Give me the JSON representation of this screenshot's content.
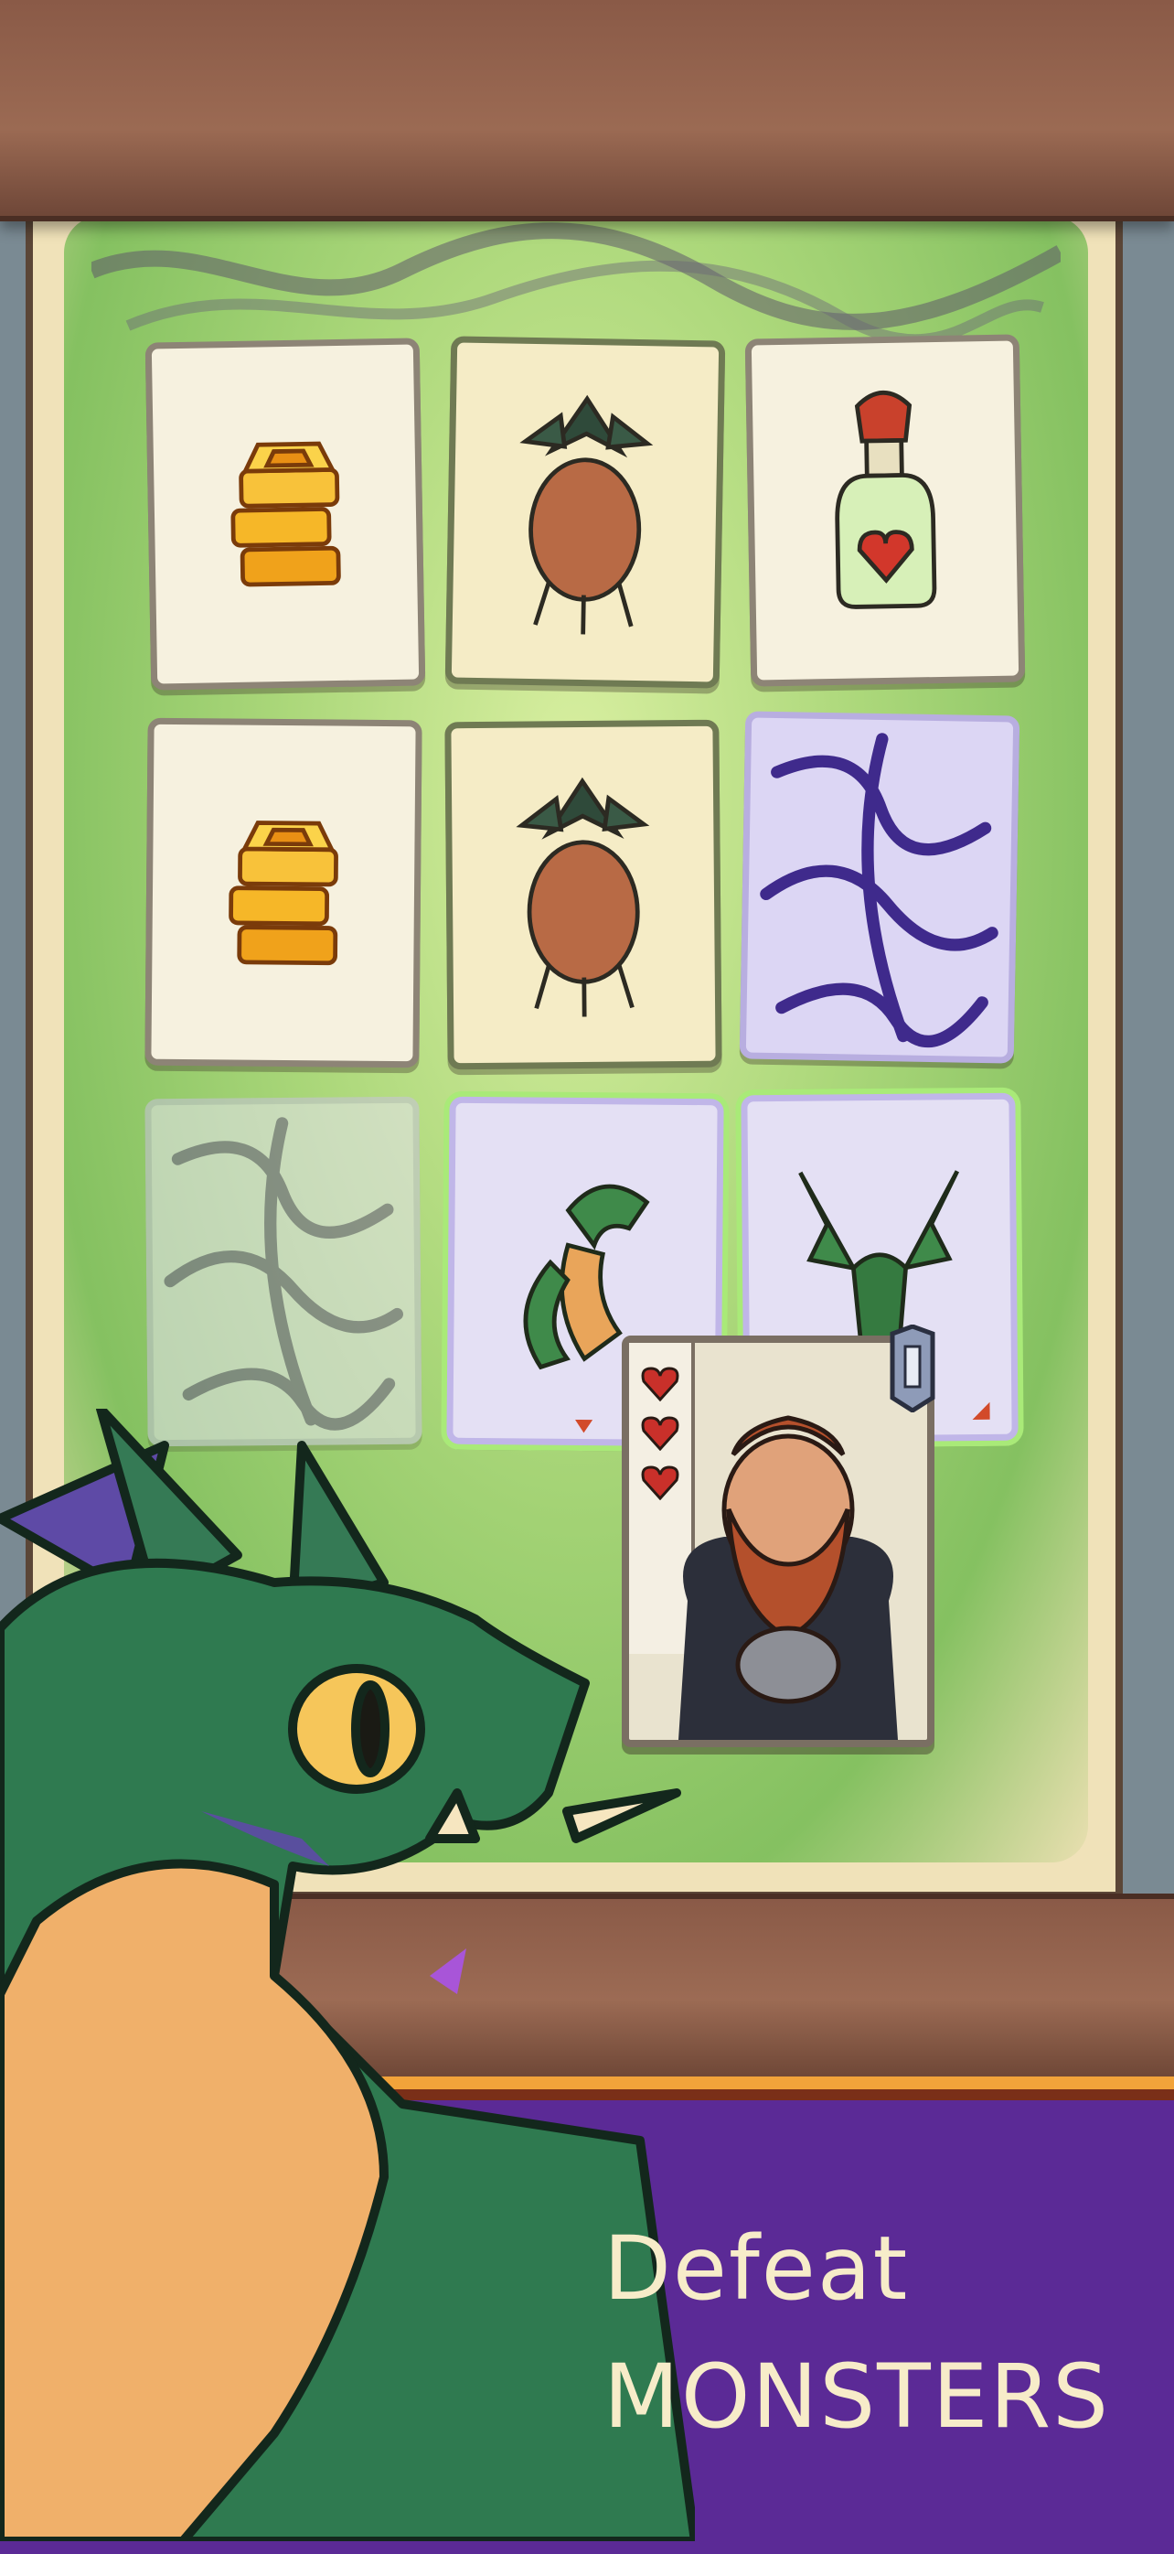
{
  "banner": {
    "line1": "Defeat",
    "line2": "MONSTERS"
  },
  "board": {
    "rows": [
      [
        "gold-coins",
        "mandrake-root",
        "health-potion"
      ],
      [
        "gold-coins",
        "mandrake-root",
        "thorn-back"
      ],
      [
        "thorn-back-faded",
        "green-dragon",
        "two-headed-dragon"
      ]
    ]
  },
  "hero": {
    "hearts": 3,
    "icon": "shield-badge-icon"
  },
  "colors": {
    "banner": "#5b2a96",
    "banner_trim": "#f2a33a",
    "wood": "#8a5a47",
    "parchment": "#f0e2b9",
    "text": "#f7ecc9"
  }
}
